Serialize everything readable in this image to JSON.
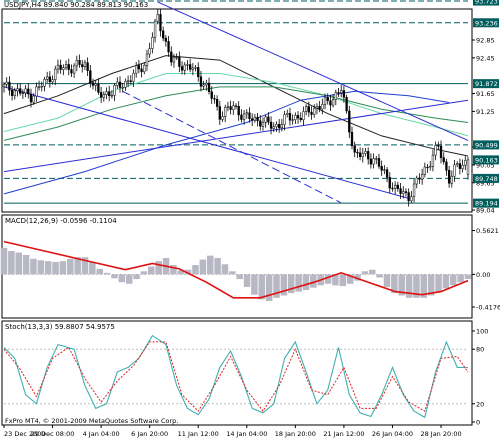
{
  "chart_window": {
    "header": "USDJPY,H4 89.840 90.284 89.813 90.163",
    "copyright": "FxPro MT4, © 2001-2009 MetaQuotes Software Corp."
  },
  "colors": {
    "frame": "#000000",
    "candle": "#000000",
    "level_line": "#005e5e",
    "price_tag_bg": "#005e5e",
    "channel": "#2b2bd6",
    "ma_black": "#222222",
    "ma_green": "#2e8b57",
    "ma_light": "#66d9a6",
    "ma_blue": "#1f3fd0",
    "macd_hist": "#b8b8c4",
    "macd_signal": "#e01010",
    "stoch_main": "#40b0b0",
    "stoch_signal": "#e02020"
  },
  "chart_data": [
    {
      "type": "candlestick",
      "title": "USDJPY,H4 89.840 90.284 89.813 90.163",
      "symbol": "USDJPY",
      "timeframe": "H4",
      "last_bar": {
        "open": 89.84,
        "high": 90.284,
        "low": 89.813,
        "close": 90.163
      },
      "ylim": [
        89.04,
        93.5
      ],
      "y_tick_labels": [
        "92.85",
        "92.45",
        "91.65",
        "91.25",
        "90.45",
        "90.05",
        "89.65",
        "89.04"
      ],
      "price_tags": [
        "93.723",
        "93.236",
        "91.872",
        "90.499",
        "90.163",
        "89.748",
        "89.194"
      ],
      "horizontal_levels": [
        93.723,
        93.236,
        91.872,
        90.499,
        89.748,
        89.194
      ],
      "x_tick_labels": [
        "23 Dec 2009",
        "29 Dec 08:00",
        "4 Jan 04:00",
        "6 Jan 20:00",
        "11 Jan 12:00",
        "14 Jan 04:00",
        "18 Jan 20:00",
        "21 Jan 12:00",
        "26 Jan 04:00",
        "28 Jan 20:00"
      ],
      "x_tick_indices": [
        0,
        18,
        36,
        54,
        72,
        90,
        108,
        126,
        144,
        162
      ],
      "bar_count": 173,
      "price_path": [
        [
          0,
          91.8
        ],
        [
          10,
          91.6
        ],
        [
          20,
          92.2
        ],
        [
          30,
          92.3
        ],
        [
          35,
          91.6
        ],
        [
          40,
          91.7
        ],
        [
          45,
          91.9
        ],
        [
          52,
          92.3
        ],
        [
          57,
          93.35
        ],
        [
          62,
          92.4
        ],
        [
          70,
          92.2
        ],
        [
          75,
          91.8
        ],
        [
          80,
          91.2
        ],
        [
          85,
          91.35
        ],
        [
          90,
          91.1
        ],
        [
          95,
          91.05
        ],
        [
          100,
          90.9
        ],
        [
          105,
          91.1
        ],
        [
          110,
          91.15
        ],
        [
          116,
          91.35
        ],
        [
          120,
          91.45
        ],
        [
          125,
          91.75
        ],
        [
          130,
          90.3
        ],
        [
          137,
          90.2
        ],
        [
          145,
          89.5
        ],
        [
          150,
          89.35
        ],
        [
          155,
          89.85
        ],
        [
          158,
          90.15
        ],
        [
          161,
          90.45
        ],
        [
          165,
          89.75
        ],
        [
          168,
          90.0
        ],
        [
          172,
          90.163
        ]
      ],
      "moving_averages": [
        {
          "color": "ma_black",
          "points": [
            [
              0,
              91.2
            ],
            [
              20,
              91.6
            ],
            [
              40,
              92.1
            ],
            [
              60,
              92.5
            ],
            [
              80,
              92.4
            ],
            [
              100,
              91.8
            ],
            [
              120,
              91.2
            ],
            [
              140,
              90.7
            ],
            [
              160,
              90.4
            ],
            [
              172,
              90.25
            ]
          ]
        },
        {
          "color": "ma_light",
          "points": [
            [
              0,
              90.8
            ],
            [
              20,
              91.1
            ],
            [
              40,
              91.7
            ],
            [
              60,
              92.1
            ],
            [
              80,
              92.1
            ],
            [
              100,
              91.9
            ],
            [
              120,
              91.6
            ],
            [
              140,
              91.2
            ],
            [
              160,
              90.9
            ],
            [
              172,
              90.7
            ]
          ]
        },
        {
          "color": "ma_green",
          "points": [
            [
              0,
              90.6
            ],
            [
              20,
              90.9
            ],
            [
              40,
              91.3
            ],
            [
              60,
              91.6
            ],
            [
              80,
              91.8
            ],
            [
              100,
              91.8
            ],
            [
              120,
              91.6
            ],
            [
              140,
              91.3
            ],
            [
              160,
              91.1
            ],
            [
              172,
              91.0
            ]
          ]
        },
        {
          "color": "ma_blue",
          "points": [
            [
              0,
              89.4
            ],
            [
              30,
              89.9
            ],
            [
              60,
              90.5
            ],
            [
              90,
              91.0
            ],
            [
              110,
              91.5
            ],
            [
              130,
              91.7
            ],
            [
              150,
              91.6
            ],
            [
              165,
              91.45
            ]
          ]
        }
      ],
      "channel_lines": [
        {
          "points": [
            [
              57,
              93.7
            ],
            [
              172,
              90.6
            ]
          ]
        },
        {
          "points": [
            [
              0,
              91.8
            ],
            [
              150,
              89.3
            ]
          ]
        },
        {
          "points": [
            [
              44,
              91.7
            ],
            [
              125,
              89.2
            ]
          ],
          "dashed": true
        },
        {
          "points": [
            [
              0,
              89.9
            ],
            [
              172,
              91.5
            ]
          ]
        }
      ]
    },
    {
      "type": "bar+line",
      "title": "MACD(12,26,9) -0.0596 -0.1104",
      "ylim": [
        -0.52,
        0.62
      ],
      "y_tick_labels": [
        "0.5621",
        "0.00",
        "-0.4176"
      ],
      "histogram": [
        0.34,
        0.3,
        0.28,
        0.25,
        0.2,
        0.18,
        0.17,
        0.16,
        0.17,
        0.2,
        0.22,
        0.22,
        0.16,
        0.07,
        0.02,
        -0.05,
        -0.1,
        -0.12,
        -0.06,
        0.04,
        0.1,
        0.17,
        0.21,
        0.12,
        0.05,
        0.06,
        0.12,
        0.19,
        0.24,
        0.21,
        0.13,
        0.04,
        -0.06,
        -0.16,
        -0.26,
        -0.32,
        -0.34,
        -0.3,
        -0.27,
        -0.24,
        -0.22,
        -0.2,
        -0.17,
        -0.14,
        -0.12,
        -0.14,
        -0.15,
        -0.12,
        -0.08,
        0.04,
        0.06,
        -0.04,
        -0.16,
        -0.24,
        -0.27,
        -0.3,
        -0.3,
        -0.3,
        -0.27,
        -0.23,
        -0.18,
        -0.14,
        -0.1,
        -0.06
      ],
      "signal": [
        [
          0,
          0.42
        ],
        [
          15,
          0.3
        ],
        [
          30,
          0.18
        ],
        [
          45,
          0.06
        ],
        [
          55,
          0.14
        ],
        [
          65,
          0.07
        ],
        [
          75,
          -0.1
        ],
        [
          85,
          -0.3
        ],
        [
          95,
          -0.3
        ],
        [
          105,
          -0.2
        ],
        [
          115,
          -0.1
        ],
        [
          125,
          0.02
        ],
        [
          135,
          -0.1
        ],
        [
          145,
          -0.22
        ],
        [
          155,
          -0.26
        ],
        [
          162,
          -0.22
        ],
        [
          172,
          -0.08
        ]
      ]
    },
    {
      "type": "line",
      "title": "Stoch(13,3,3) 59.8807 54.9575",
      "ylim": [
        0,
        100
      ],
      "y_tick_labels": [
        "100",
        "80",
        "20",
        "0"
      ],
      "main": [
        [
          0,
          82
        ],
        [
          4,
          70
        ],
        [
          8,
          30
        ],
        [
          12,
          20
        ],
        [
          16,
          60
        ],
        [
          20,
          85
        ],
        [
          26,
          80
        ],
        [
          30,
          40
        ],
        [
          34,
          15
        ],
        [
          38,
          20
        ],
        [
          42,
          55
        ],
        [
          46,
          60
        ],
        [
          50,
          70
        ],
        [
          55,
          95
        ],
        [
          60,
          85
        ],
        [
          64,
          40
        ],
        [
          68,
          15
        ],
        [
          72,
          8
        ],
        [
          76,
          25
        ],
        [
          80,
          60
        ],
        [
          84,
          78
        ],
        [
          88,
          50
        ],
        [
          92,
          15
        ],
        [
          96,
          10
        ],
        [
          100,
          20
        ],
        [
          104,
          70
        ],
        [
          108,
          88
        ],
        [
          112,
          55
        ],
        [
          116,
          20
        ],
        [
          120,
          35
        ],
        [
          124,
          82
        ],
        [
          128,
          30
        ],
        [
          132,
          10
        ],
        [
          136,
          6
        ],
        [
          140,
          30
        ],
        [
          144,
          60
        ],
        [
          148,
          30
        ],
        [
          152,
          12
        ],
        [
          156,
          5
        ],
        [
          160,
          55
        ],
        [
          164,
          88
        ],
        [
          168,
          60
        ],
        [
          172,
          59.88
        ]
      ],
      "signal": [
        [
          0,
          80
        ],
        [
          6,
          58
        ],
        [
          12,
          28
        ],
        [
          18,
          70
        ],
        [
          24,
          82
        ],
        [
          30,
          48
        ],
        [
          36,
          22
        ],
        [
          42,
          45
        ],
        [
          48,
          62
        ],
        [
          54,
          88
        ],
        [
          60,
          88
        ],
        [
          66,
          30
        ],
        [
          72,
          12
        ],
        [
          78,
          40
        ],
        [
          84,
          72
        ],
        [
          90,
          35
        ],
        [
          96,
          12
        ],
        [
          102,
          40
        ],
        [
          108,
          80
        ],
        [
          114,
          35
        ],
        [
          120,
          30
        ],
        [
          126,
          60
        ],
        [
          132,
          15
        ],
        [
          138,
          15
        ],
        [
          144,
          50
        ],
        [
          150,
          22
        ],
        [
          156,
          12
        ],
        [
          162,
          70
        ],
        [
          168,
          72
        ],
        [
          172,
          54.96
        ]
      ]
    }
  ]
}
